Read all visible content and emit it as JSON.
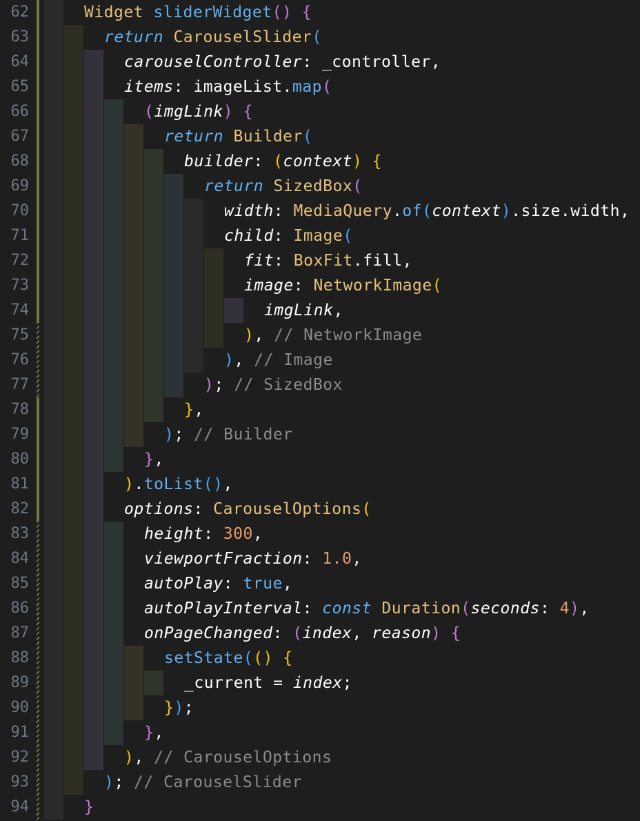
{
  "editor": {
    "lines": [
      {
        "n": "62",
        "indent": 2,
        "segs": [
          [
            "Widget ",
            "cls"
          ],
          [
            "sliderWidget",
            "fn"
          ],
          [
            "(",
            "p2"
          ],
          [
            ")",
            "p2"
          ],
          [
            " ",
            "plain"
          ],
          [
            "{",
            "p2"
          ]
        ]
      },
      {
        "n": "63",
        "indent": 3,
        "segs": [
          [
            "return ",
            "kw"
          ],
          [
            "CarouselSlider",
            "cls"
          ],
          [
            "(",
            "p3"
          ]
        ]
      },
      {
        "n": "64",
        "indent": 4,
        "segs": [
          [
            "carouselController",
            "prm"
          ],
          [
            ": _controller,",
            "plain"
          ]
        ]
      },
      {
        "n": "65",
        "indent": 4,
        "segs": [
          [
            "items",
            "prm"
          ],
          [
            ": imageList.",
            "plain"
          ],
          [
            "map",
            "fn"
          ],
          [
            "(",
            "p2"
          ]
        ]
      },
      {
        "n": "66",
        "indent": 5,
        "segs": [
          [
            "(",
            "p2"
          ],
          [
            "imgLink",
            "prm"
          ],
          [
            ")",
            "p2"
          ],
          [
            " ",
            "plain"
          ],
          [
            "{",
            "p2"
          ]
        ]
      },
      {
        "n": "67",
        "indent": 6,
        "segs": [
          [
            "return ",
            "kw"
          ],
          [
            "Builder",
            "cls"
          ],
          [
            "(",
            "p3"
          ]
        ]
      },
      {
        "n": "68",
        "indent": 7,
        "segs": [
          [
            "builder",
            "prm"
          ],
          [
            ": ",
            "plain"
          ],
          [
            "(",
            "p1"
          ],
          [
            "context",
            "prm"
          ],
          [
            ")",
            "p1"
          ],
          [
            " ",
            "plain"
          ],
          [
            "{",
            "p1"
          ]
        ]
      },
      {
        "n": "69",
        "indent": 8,
        "segs": [
          [
            "return ",
            "kw"
          ],
          [
            "SizedBox",
            "cls"
          ],
          [
            "(",
            "p2"
          ]
        ]
      },
      {
        "n": "70",
        "indent": 9,
        "segs": [
          [
            "width",
            "prm"
          ],
          [
            ": ",
            "plain"
          ],
          [
            "MediaQuery",
            "cls"
          ],
          [
            ".",
            "plain"
          ],
          [
            "of",
            "fn"
          ],
          [
            "(",
            "p3"
          ],
          [
            "context",
            "prm"
          ],
          [
            ")",
            "p3"
          ],
          [
            ".size.width,",
            "plain"
          ]
        ]
      },
      {
        "n": "71",
        "indent": 9,
        "segs": [
          [
            "child",
            "prm"
          ],
          [
            ": ",
            "plain"
          ],
          [
            "Image",
            "cls"
          ],
          [
            "(",
            "p3"
          ]
        ]
      },
      {
        "n": "72",
        "indent": 10,
        "segs": [
          [
            "fit",
            "prm"
          ],
          [
            ": ",
            "plain"
          ],
          [
            "BoxFit",
            "cls"
          ],
          [
            ".fill,",
            "plain"
          ]
        ]
      },
      {
        "n": "73",
        "indent": 10,
        "segs": [
          [
            "image",
            "prm"
          ],
          [
            ": ",
            "plain"
          ],
          [
            "NetworkImage",
            "cls"
          ],
          [
            "(",
            "p1"
          ]
        ]
      },
      {
        "n": "74",
        "indent": 11,
        "segs": [
          [
            "imgLink",
            "prm"
          ],
          [
            ",",
            "plain"
          ]
        ]
      },
      {
        "n": "75",
        "indent": 10,
        "segs": [
          [
            ")",
            "p1"
          ],
          [
            ", ",
            "plain"
          ],
          [
            "// NetworkImage",
            "cmt"
          ]
        ]
      },
      {
        "n": "76",
        "indent": 9,
        "segs": [
          [
            ")",
            "p3"
          ],
          [
            ", ",
            "plain"
          ],
          [
            "// Image",
            "cmt"
          ]
        ]
      },
      {
        "n": "77",
        "indent": 8,
        "segs": [
          [
            ")",
            "p2"
          ],
          [
            "; ",
            "plain"
          ],
          [
            "// SizedBox",
            "cmt"
          ]
        ]
      },
      {
        "n": "78",
        "indent": 7,
        "segs": [
          [
            "}",
            "p1"
          ],
          [
            ",",
            "plain"
          ]
        ]
      },
      {
        "n": "79",
        "indent": 6,
        "segs": [
          [
            ")",
            "p3"
          ],
          [
            "; ",
            "plain"
          ],
          [
            "// Builder",
            "cmt"
          ]
        ]
      },
      {
        "n": "80",
        "indent": 5,
        "segs": [
          [
            "}",
            "p2"
          ],
          [
            ",",
            "plain"
          ]
        ]
      },
      {
        "n": "81",
        "indent": 4,
        "segs": [
          [
            ")",
            "p1"
          ],
          [
            ".",
            "plain"
          ],
          [
            "toList",
            "fn"
          ],
          [
            "()",
            "p3"
          ],
          [
            ",",
            "plain"
          ]
        ]
      },
      {
        "n": "82",
        "indent": 4,
        "segs": [
          [
            "options",
            "prm"
          ],
          [
            ": ",
            "plain"
          ],
          [
            "CarouselOptions",
            "cls"
          ],
          [
            "(",
            "p1"
          ]
        ]
      },
      {
        "n": "83",
        "indent": 5,
        "segs": [
          [
            "height",
            "prm"
          ],
          [
            ": ",
            "plain"
          ],
          [
            "300",
            "num"
          ],
          [
            ",",
            "plain"
          ]
        ]
      },
      {
        "n": "84",
        "indent": 5,
        "segs": [
          [
            "viewportFraction",
            "prm"
          ],
          [
            ": ",
            "plain"
          ],
          [
            "1.0",
            "num"
          ],
          [
            ",",
            "plain"
          ]
        ]
      },
      {
        "n": "85",
        "indent": 5,
        "segs": [
          [
            "autoPlay",
            "prm"
          ],
          [
            ": ",
            "plain"
          ],
          [
            "true",
            "bool"
          ],
          [
            ",",
            "plain"
          ]
        ]
      },
      {
        "n": "86",
        "indent": 5,
        "segs": [
          [
            "autoPlayInterval",
            "prm"
          ],
          [
            ": ",
            "plain"
          ],
          [
            "const ",
            "kw"
          ],
          [
            "Duration",
            "cls"
          ],
          [
            "(",
            "p2"
          ],
          [
            "seconds",
            "prm"
          ],
          [
            ": ",
            "plain"
          ],
          [
            "4",
            "num"
          ],
          [
            ")",
            "p2"
          ],
          [
            ",",
            "plain"
          ]
        ]
      },
      {
        "n": "87",
        "indent": 5,
        "segs": [
          [
            "onPageChanged",
            "prm"
          ],
          [
            ": ",
            "plain"
          ],
          [
            "(",
            "p2"
          ],
          [
            "index",
            "prm"
          ],
          [
            ", ",
            "plain"
          ],
          [
            "reason",
            "prm"
          ],
          [
            ")",
            "p2"
          ],
          [
            " ",
            "plain"
          ],
          [
            "{",
            "p2"
          ]
        ]
      },
      {
        "n": "88",
        "indent": 6,
        "segs": [
          [
            "setState",
            "fn"
          ],
          [
            "(",
            "p3"
          ],
          [
            "()",
            "p1"
          ],
          [
            " ",
            "plain"
          ],
          [
            "{",
            "p1"
          ]
        ]
      },
      {
        "n": "89",
        "indent": 7,
        "segs": [
          [
            "_current = ",
            "plain"
          ],
          [
            "index",
            "prm"
          ],
          [
            ";",
            "plain"
          ]
        ]
      },
      {
        "n": "90",
        "indent": 6,
        "segs": [
          [
            "}",
            "p1"
          ],
          [
            ")",
            "p3"
          ],
          [
            ";",
            "plain"
          ]
        ]
      },
      {
        "n": "91",
        "indent": 5,
        "segs": [
          [
            "}",
            "p2"
          ],
          [
            ",",
            "plain"
          ]
        ]
      },
      {
        "n": "92",
        "indent": 4,
        "segs": [
          [
            ")",
            "p1"
          ],
          [
            ", ",
            "plain"
          ],
          [
            "// CarouselOptions",
            "cmt"
          ]
        ]
      },
      {
        "n": "93",
        "indent": 3,
        "segs": [
          [
            ")",
            "p3"
          ],
          [
            "; ",
            "plain"
          ],
          [
            "// CarouselSlider",
            "cmt"
          ]
        ]
      },
      {
        "n": "94",
        "indent": 2,
        "segs": [
          [
            "}",
            "p2"
          ]
        ]
      }
    ]
  },
  "colors": {
    "background": "#1e1e1e",
    "line_number": "#6e7681",
    "git_modified_bar": "#6e7a3c",
    "indent_guides": [
      "#2a2a2a",
      "#2f2e22",
      "#34313d",
      "#2b3634",
      "#353124",
      "#2e3529",
      "#2b3337"
    ]
  }
}
